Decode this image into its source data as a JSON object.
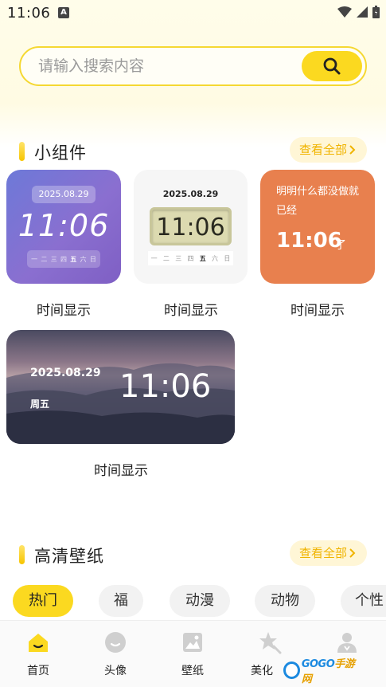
{
  "status_bar": {
    "time": "11:06",
    "notification_badge": "A"
  },
  "search": {
    "placeholder": "请输入搜索内容",
    "icon": "search-icon"
  },
  "widgets_section": {
    "title": "小组件",
    "see_all": "查看全部"
  },
  "widgets": [
    {
      "label": "时间显示",
      "date": "2025.08.29",
      "time": "11:06",
      "week": [
        "一",
        "二",
        "三",
        "四",
        "五",
        "六",
        "日"
      ],
      "active_day": "五"
    },
    {
      "label": "时间显示",
      "date": "2025.08.29",
      "time": "11:06",
      "week": [
        "一",
        "二",
        "三",
        "四",
        "五",
        "六",
        "日"
      ],
      "active_day": "五"
    },
    {
      "label": "时间显示",
      "text": "明明什么都没做就已经",
      "time": "11:06",
      "suffix": "了"
    },
    {
      "label": "时间显示",
      "date": "2025.08.29",
      "weekday": "周五",
      "time": "11:06"
    }
  ],
  "wallpaper_section": {
    "title": "高清壁纸",
    "see_all": "查看全部"
  },
  "tags": [
    "热门",
    "福",
    "动漫",
    "动物",
    "个性"
  ],
  "active_tag": "热门",
  "bottom_nav": [
    {
      "label": "首页",
      "icon": "home-icon",
      "active": true
    },
    {
      "label": "头像",
      "icon": "avatar-icon",
      "active": false
    },
    {
      "label": "壁纸",
      "icon": "wallpaper-icon",
      "active": false
    },
    {
      "label": "美化",
      "icon": "beautify-icon",
      "active": false
    },
    {
      "label": "我的",
      "icon": "user-icon",
      "active": false
    }
  ],
  "watermark": {
    "text_a": "GOGO",
    "text_b": "手游网"
  },
  "colors": {
    "accent": "#fbd920",
    "accent_text": "#f0b400",
    "widget_purple": "#7a72d2",
    "widget_orange": "#e8804e"
  }
}
